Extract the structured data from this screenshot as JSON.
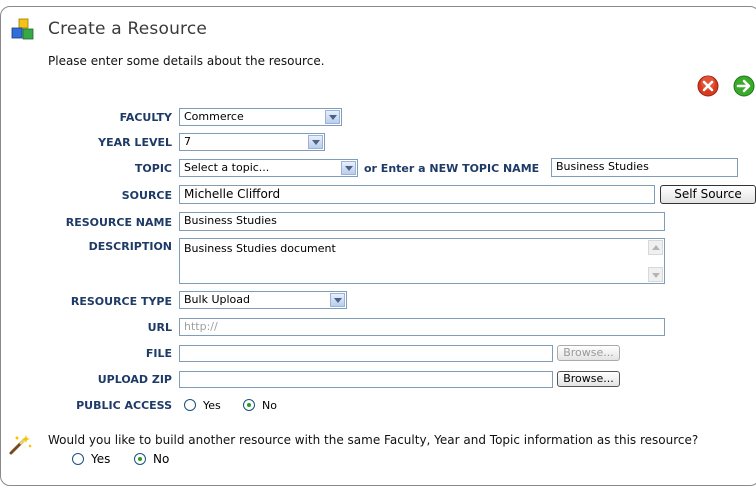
{
  "header": {
    "title": "Create a Resource",
    "intro": "Please enter some details about the resource."
  },
  "actions": {
    "cancel_icon": "cancel-icon",
    "next_icon": "next-arrow-icon"
  },
  "form": {
    "faculty": {
      "label": "FACULTY",
      "value": "Commerce"
    },
    "year_level": {
      "label": "YEAR LEVEL",
      "value": "7"
    },
    "topic": {
      "label": "TOPIC",
      "value": "Select a topic...",
      "new_topic_label": "or Enter a NEW TOPIC NAME",
      "new_topic_value": "Business Studies"
    },
    "source": {
      "label": "SOURCE",
      "value": "Michelle Clifford",
      "button": "Self Source"
    },
    "resource_name": {
      "label": "RESOURCE NAME",
      "value": "Business Studies"
    },
    "description": {
      "label": "DESCRIPTION",
      "value": "Business Studies document"
    },
    "resource_type": {
      "label": "RESOURCE TYPE",
      "value": "Bulk Upload"
    },
    "url": {
      "label": "URL",
      "placeholder": "http://"
    },
    "file": {
      "label": "FILE",
      "value": "",
      "button": "Browse..."
    },
    "upload_zip": {
      "label": "UPLOAD ZIP",
      "value": "",
      "button": "Browse..."
    },
    "public_access": {
      "label": "PUBLIC ACCESS",
      "yes": "Yes",
      "no": "No",
      "selected": "No"
    }
  },
  "repeat": {
    "question": "Would you like to build another resource with the same Faculty, Year and Topic information as this resource?",
    "yes": "Yes",
    "no": "No",
    "selected": "No"
  },
  "colors": {
    "label": "#1e3a66",
    "border": "#7f9db9",
    "accent_radio": "#21a121"
  }
}
